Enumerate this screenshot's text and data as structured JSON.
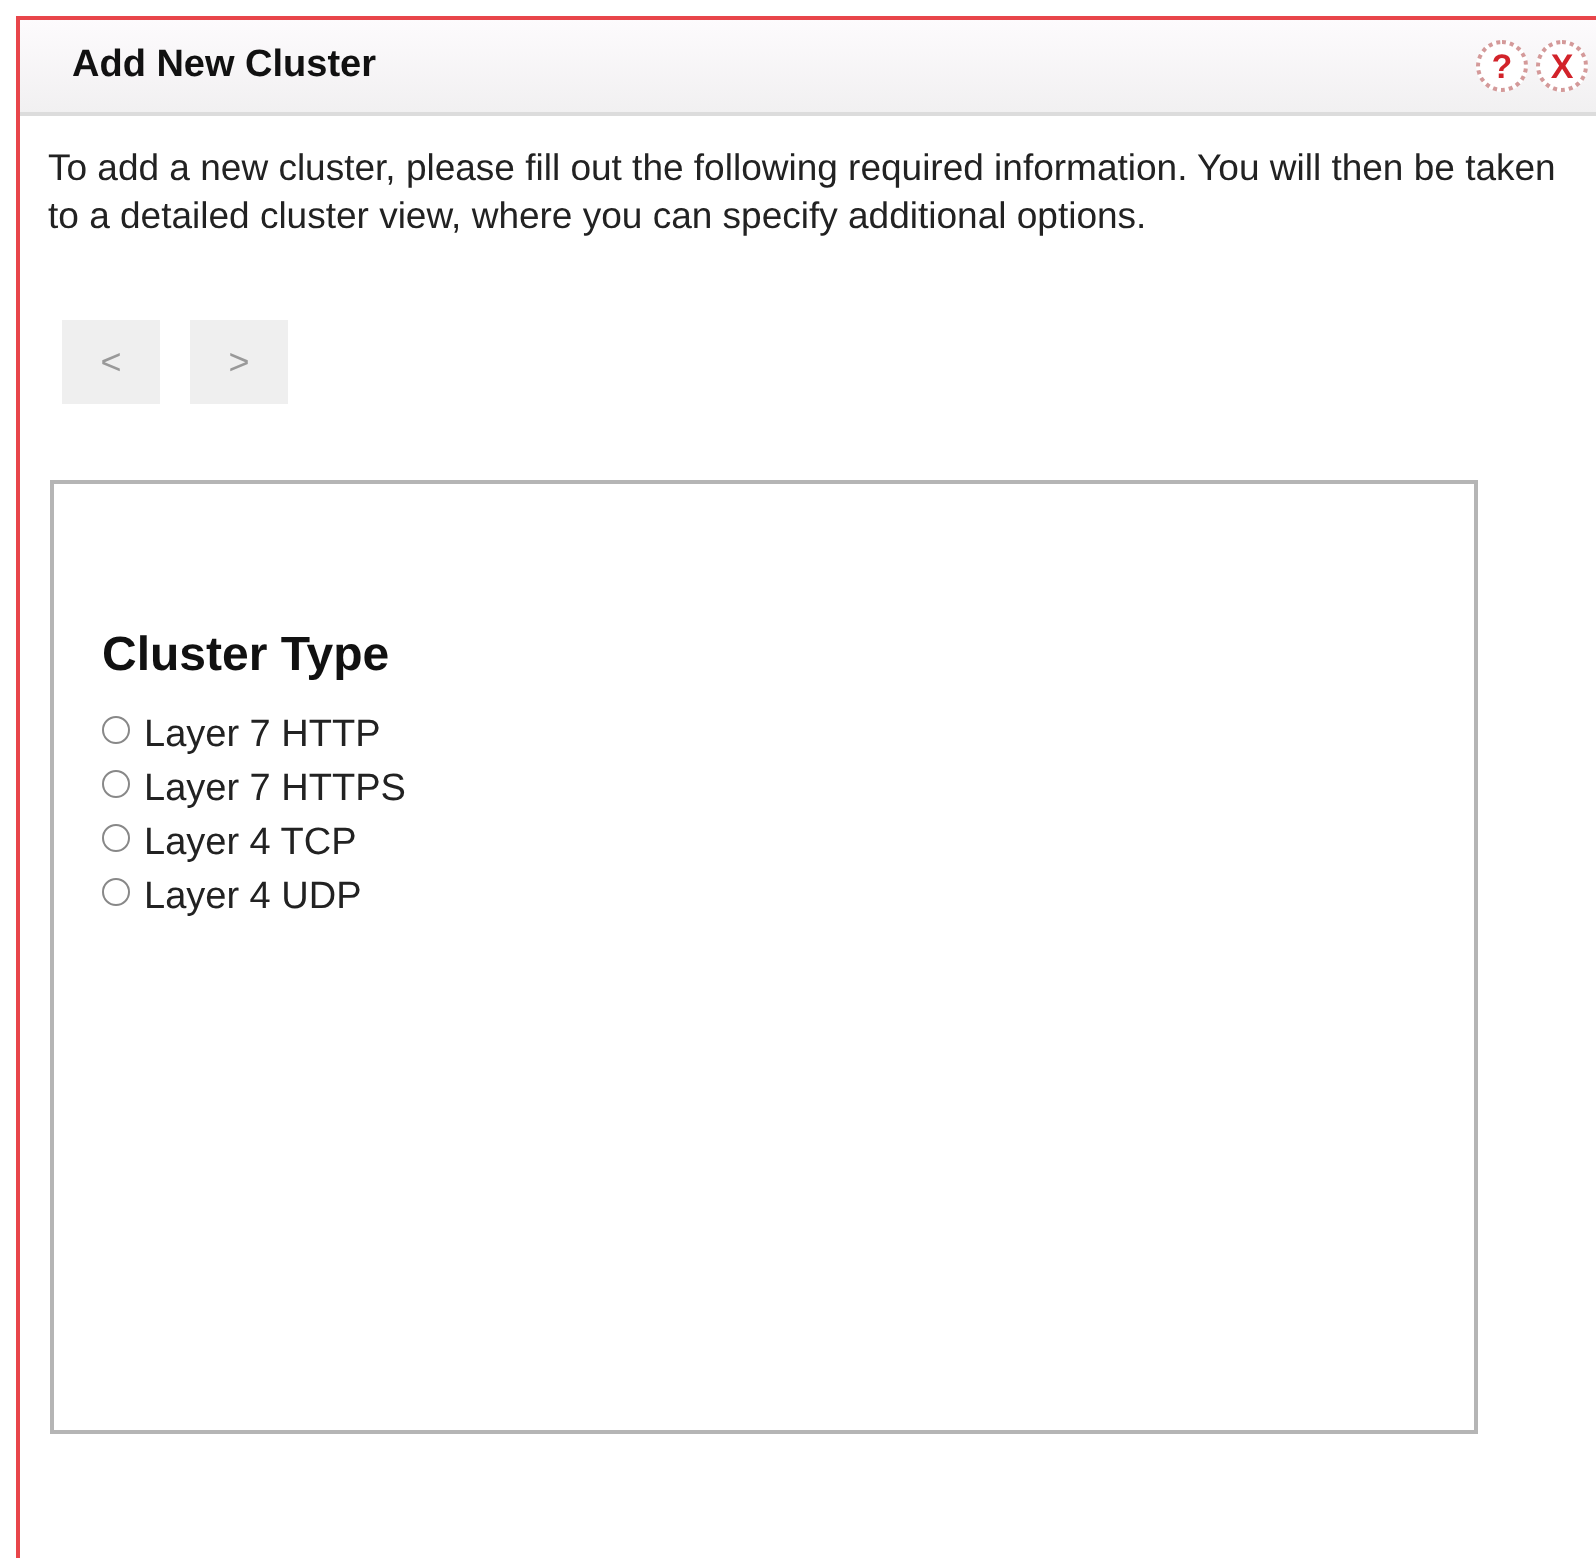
{
  "window": {
    "title": "Add New Cluster",
    "help_button": "?",
    "close_button": "X"
  },
  "description": "To add a new cluster, please fill out the following required information. You will then be taken to a detailed cluster view, where you can specify additional options.",
  "nav_buttons": [
    {
      "label": "<",
      "disabled": true
    },
    {
      "label": ">",
      "disabled": true
    }
  ],
  "panel": {
    "heading": "Cluster Type",
    "options": [
      {
        "label": "Layer 7 HTTP",
        "selected": false
      },
      {
        "label": "Layer 7 HTTPS",
        "selected": false
      },
      {
        "label": "Layer 4 TCP",
        "selected": false
      },
      {
        "label": "Layer 4 UDP",
        "selected": false
      }
    ]
  }
}
